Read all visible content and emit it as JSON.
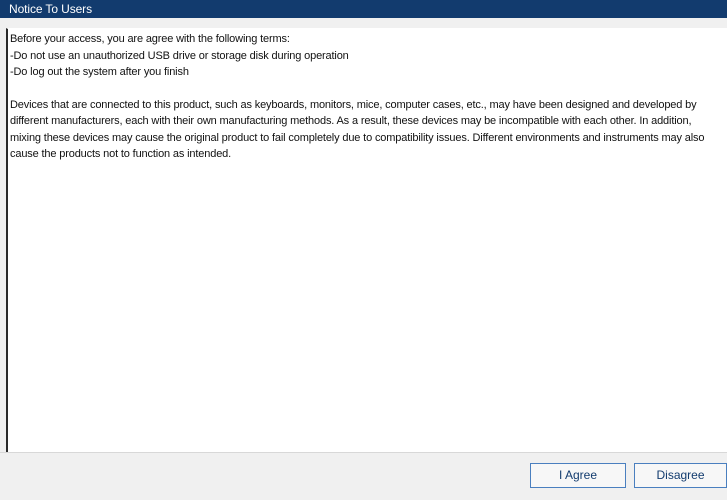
{
  "window": {
    "title": "Notice To Users"
  },
  "notice": {
    "intro": "Before your access, you are agree with the following terms:",
    "terms": [
      "-Do not use an unauthorized USB drive or storage disk during operation",
      "-Do log out the system after you finish"
    ],
    "body": "Devices that are connected to this product, such as keyboards, monitors, mice, computer cases, etc., may have been designed and developed by different manufacturers, each with their own manufacturing methods. As a result, these devices may be incompatible with each other. In addition, mixing these devices may cause the original product to fail completely due to compatibility issues. Different environments and instruments may also cause the products not to function as intended."
  },
  "buttons": {
    "agree_label": "I Agree",
    "disagree_label": "Disagree"
  },
  "colors": {
    "titlebar": "#123b6e",
    "button_border": "#4a7fbf",
    "button_text": "#123b6e"
  }
}
